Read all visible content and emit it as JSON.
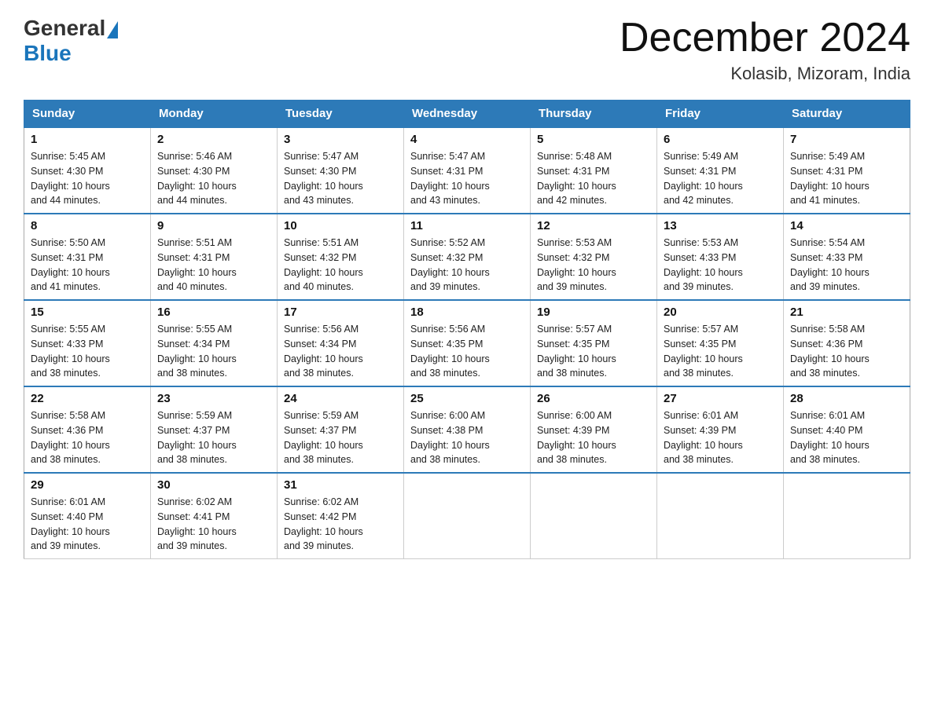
{
  "logo": {
    "general": "General",
    "blue": "Blue"
  },
  "title": "December 2024",
  "location": "Kolasib, Mizoram, India",
  "days_of_week": [
    "Sunday",
    "Monday",
    "Tuesday",
    "Wednesday",
    "Thursday",
    "Friday",
    "Saturday"
  ],
  "weeks": [
    [
      {
        "day": "1",
        "sunrise": "5:45 AM",
        "sunset": "4:30 PM",
        "daylight": "10 hours and 44 minutes."
      },
      {
        "day": "2",
        "sunrise": "5:46 AM",
        "sunset": "4:30 PM",
        "daylight": "10 hours and 44 minutes."
      },
      {
        "day": "3",
        "sunrise": "5:47 AM",
        "sunset": "4:30 PM",
        "daylight": "10 hours and 43 minutes."
      },
      {
        "day": "4",
        "sunrise": "5:47 AM",
        "sunset": "4:31 PM",
        "daylight": "10 hours and 43 minutes."
      },
      {
        "day": "5",
        "sunrise": "5:48 AM",
        "sunset": "4:31 PM",
        "daylight": "10 hours and 42 minutes."
      },
      {
        "day": "6",
        "sunrise": "5:49 AM",
        "sunset": "4:31 PM",
        "daylight": "10 hours and 42 minutes."
      },
      {
        "day": "7",
        "sunrise": "5:49 AM",
        "sunset": "4:31 PM",
        "daylight": "10 hours and 41 minutes."
      }
    ],
    [
      {
        "day": "8",
        "sunrise": "5:50 AM",
        "sunset": "4:31 PM",
        "daylight": "10 hours and 41 minutes."
      },
      {
        "day": "9",
        "sunrise": "5:51 AM",
        "sunset": "4:31 PM",
        "daylight": "10 hours and 40 minutes."
      },
      {
        "day": "10",
        "sunrise": "5:51 AM",
        "sunset": "4:32 PM",
        "daylight": "10 hours and 40 minutes."
      },
      {
        "day": "11",
        "sunrise": "5:52 AM",
        "sunset": "4:32 PM",
        "daylight": "10 hours and 39 minutes."
      },
      {
        "day": "12",
        "sunrise": "5:53 AM",
        "sunset": "4:32 PM",
        "daylight": "10 hours and 39 minutes."
      },
      {
        "day": "13",
        "sunrise": "5:53 AM",
        "sunset": "4:33 PM",
        "daylight": "10 hours and 39 minutes."
      },
      {
        "day": "14",
        "sunrise": "5:54 AM",
        "sunset": "4:33 PM",
        "daylight": "10 hours and 39 minutes."
      }
    ],
    [
      {
        "day": "15",
        "sunrise": "5:55 AM",
        "sunset": "4:33 PM",
        "daylight": "10 hours and 38 minutes."
      },
      {
        "day": "16",
        "sunrise": "5:55 AM",
        "sunset": "4:34 PM",
        "daylight": "10 hours and 38 minutes."
      },
      {
        "day": "17",
        "sunrise": "5:56 AM",
        "sunset": "4:34 PM",
        "daylight": "10 hours and 38 minutes."
      },
      {
        "day": "18",
        "sunrise": "5:56 AM",
        "sunset": "4:35 PM",
        "daylight": "10 hours and 38 minutes."
      },
      {
        "day": "19",
        "sunrise": "5:57 AM",
        "sunset": "4:35 PM",
        "daylight": "10 hours and 38 minutes."
      },
      {
        "day": "20",
        "sunrise": "5:57 AM",
        "sunset": "4:35 PM",
        "daylight": "10 hours and 38 minutes."
      },
      {
        "day": "21",
        "sunrise": "5:58 AM",
        "sunset": "4:36 PM",
        "daylight": "10 hours and 38 minutes."
      }
    ],
    [
      {
        "day": "22",
        "sunrise": "5:58 AM",
        "sunset": "4:36 PM",
        "daylight": "10 hours and 38 minutes."
      },
      {
        "day": "23",
        "sunrise": "5:59 AM",
        "sunset": "4:37 PM",
        "daylight": "10 hours and 38 minutes."
      },
      {
        "day": "24",
        "sunrise": "5:59 AM",
        "sunset": "4:37 PM",
        "daylight": "10 hours and 38 minutes."
      },
      {
        "day": "25",
        "sunrise": "6:00 AM",
        "sunset": "4:38 PM",
        "daylight": "10 hours and 38 minutes."
      },
      {
        "day": "26",
        "sunrise": "6:00 AM",
        "sunset": "4:39 PM",
        "daylight": "10 hours and 38 minutes."
      },
      {
        "day": "27",
        "sunrise": "6:01 AM",
        "sunset": "4:39 PM",
        "daylight": "10 hours and 38 minutes."
      },
      {
        "day": "28",
        "sunrise": "6:01 AM",
        "sunset": "4:40 PM",
        "daylight": "10 hours and 38 minutes."
      }
    ],
    [
      {
        "day": "29",
        "sunrise": "6:01 AM",
        "sunset": "4:40 PM",
        "daylight": "10 hours and 39 minutes."
      },
      {
        "day": "30",
        "sunrise": "6:02 AM",
        "sunset": "4:41 PM",
        "daylight": "10 hours and 39 minutes."
      },
      {
        "day": "31",
        "sunrise": "6:02 AM",
        "sunset": "4:42 PM",
        "daylight": "10 hours and 39 minutes."
      },
      null,
      null,
      null,
      null
    ]
  ],
  "labels": {
    "sunrise": "Sunrise:",
    "sunset": "Sunset:",
    "daylight": "Daylight:"
  }
}
